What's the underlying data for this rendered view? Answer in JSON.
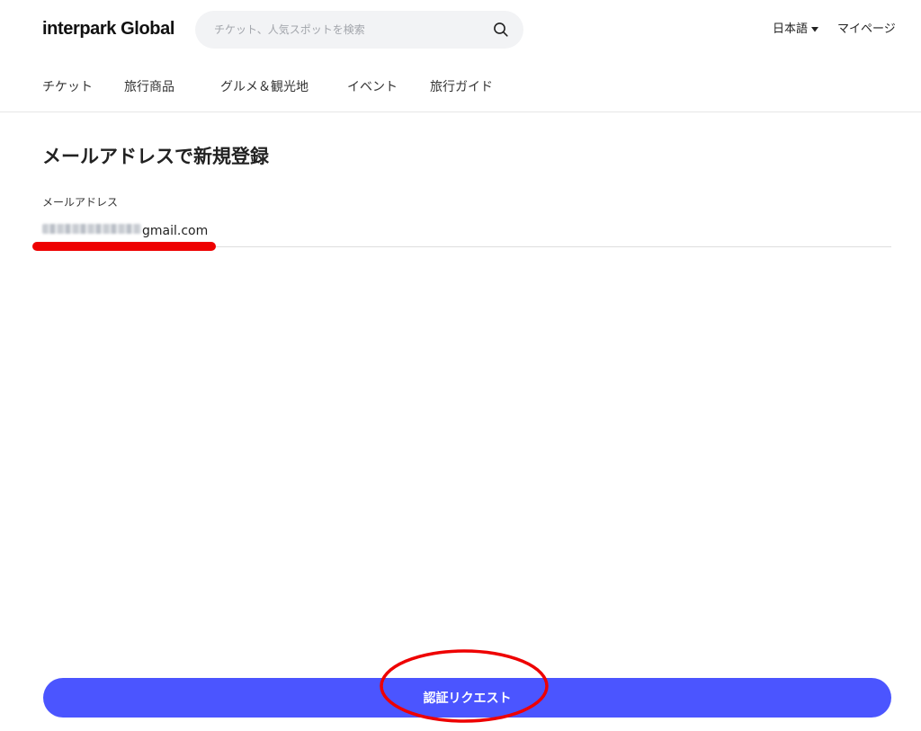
{
  "header": {
    "logo": "interpark Global",
    "search": {
      "placeholder": "チケット、人気スポットを検索",
      "value": "",
      "icon": "search-icon"
    },
    "language": {
      "label": "日本語",
      "icon": "caret-down-icon"
    },
    "mypage": "マイページ"
  },
  "nav": {
    "items": [
      {
        "label": "チケット"
      },
      {
        "label": "旅行商品"
      },
      {
        "label": "グルメ＆観光地"
      },
      {
        "label": "イベント"
      },
      {
        "label": "旅行ガイド"
      }
    ]
  },
  "form": {
    "title": "メールアドレスで新規登録",
    "email": {
      "label": "メールアドレス",
      "visible_value": "gmail.com"
    },
    "submit_label": "認証リクエスト"
  },
  "colors": {
    "primary": "#4b55ff",
    "annotation": "#ee0000",
    "search_bg": "#f2f3f5",
    "divider": "#e6e6e6"
  }
}
